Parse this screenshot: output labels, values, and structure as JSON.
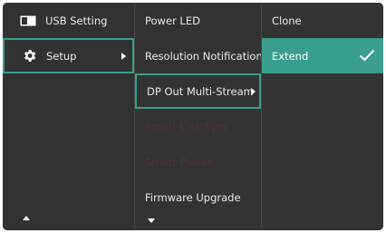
{
  "menu": {
    "level1": [
      {
        "label": "USB Setting",
        "icon": "usb-setting-icon"
      },
      {
        "label": "Setup",
        "icon": "gear-icon"
      }
    ],
    "level2": [
      {
        "label": "Power LED"
      },
      {
        "label": "Resolution Notification"
      },
      {
        "label": "DP Out Multi-Stream"
      },
      {
        "label": "Smart Link Sync"
      },
      {
        "label": "Smart Power"
      },
      {
        "label": "Firmware Upgrade"
      }
    ],
    "level3": [
      {
        "label": "Clone"
      },
      {
        "label": "Extend"
      }
    ]
  },
  "colors": {
    "panel": "#333333",
    "accent": "#3a9e8c",
    "disabled_text": "#5a2f3a",
    "text": "#e8e8e8"
  }
}
